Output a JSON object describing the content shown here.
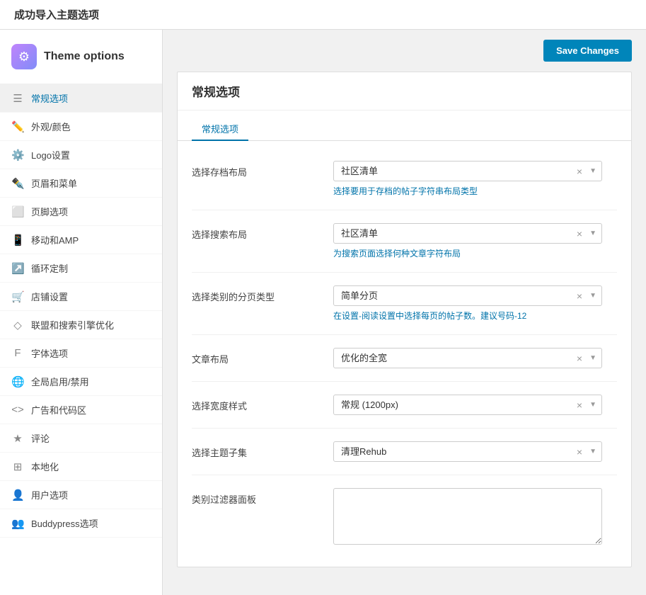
{
  "notice": {
    "text": "成功导入主题选项"
  },
  "sidebar": {
    "header": {
      "title": "Theme options",
      "icon": "⚙"
    },
    "items": [
      {
        "id": "general",
        "icon": "☰",
        "label": "常规选项",
        "active": true
      },
      {
        "id": "appearance",
        "icon": "✏",
        "label": "外观/颜色",
        "active": false
      },
      {
        "id": "logo",
        "icon": "⚙",
        "label": "Logo设置",
        "active": false
      },
      {
        "id": "header-menu",
        "icon": "✎",
        "label": "页眉和菜单",
        "active": false
      },
      {
        "id": "footer",
        "icon": "▭",
        "label": "页脚选项",
        "active": false
      },
      {
        "id": "mobile-amp",
        "icon": "☐",
        "label": "移动和AMP",
        "active": false
      },
      {
        "id": "loop",
        "icon": "↗",
        "label": "循环定制",
        "active": false
      },
      {
        "id": "shop",
        "icon": "⊞",
        "label": "店铺设置",
        "active": false
      },
      {
        "id": "seo",
        "icon": "◇",
        "label": "联盟和搜索引擎优化",
        "active": false
      },
      {
        "id": "typography",
        "icon": "𝑓",
        "label": "字体选项",
        "active": false
      },
      {
        "id": "global",
        "icon": "⊕",
        "label": "全局启用/禁用",
        "active": false
      },
      {
        "id": "ads",
        "icon": "<>",
        "label": "广告和代码区",
        "active": false
      },
      {
        "id": "comments",
        "icon": "★",
        "label": "评论",
        "active": false
      },
      {
        "id": "localization",
        "icon": "⊞",
        "label": "本地化",
        "active": false
      },
      {
        "id": "users",
        "icon": "👤",
        "label": "用户选项",
        "active": false
      },
      {
        "id": "buddypress",
        "icon": "⊞",
        "label": "Buddypress选项",
        "active": false
      }
    ]
  },
  "content": {
    "save_label": "Save Changes",
    "panel_title": "常规选项",
    "tab_label": "常规选项",
    "fields": [
      {
        "id": "archive-layout",
        "label": "选择存档布局",
        "type": "select",
        "value": "社区清单",
        "hint": "选择要用于存档的帖子字符串布局类型",
        "hint_type": "text"
      },
      {
        "id": "search-layout",
        "label": "选择搜索布局",
        "type": "select",
        "value": "社区清单",
        "hint": "为搜索页面选择何种文章字符布局",
        "hint_type": "text"
      },
      {
        "id": "category-pagination",
        "label": "选择类别的分页类型",
        "type": "select",
        "value": "简单分页",
        "hint_part1": "在设置-阅读设置中选择每页的帖子数。建议号码-",
        "hint_link": "12",
        "hint_type": "link"
      },
      {
        "id": "post-layout",
        "label": "文章布局",
        "type": "select",
        "value": "优化的全宽",
        "hint": "",
        "hint_type": "none"
      },
      {
        "id": "width-style",
        "label": "选择宽度样式",
        "type": "select",
        "value": "常规 (1200px)",
        "hint": "",
        "hint_type": "none"
      },
      {
        "id": "theme-skin",
        "label": "选择主题子集",
        "type": "select",
        "value": "清理Rehub",
        "hint": "",
        "hint_type": "none"
      },
      {
        "id": "category-filter",
        "label": "类别过滤器面板",
        "type": "textarea",
        "value": "",
        "hint": "",
        "hint_type": "none"
      }
    ]
  }
}
